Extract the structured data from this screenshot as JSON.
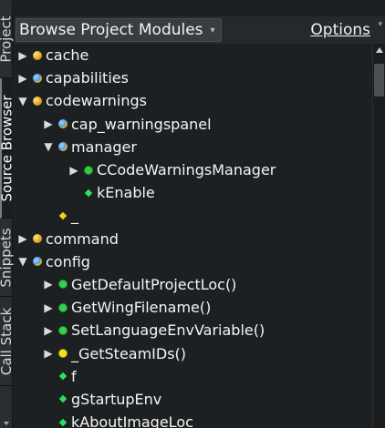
{
  "side_tabs": {
    "project": "Project",
    "source_browser": "Source Browser",
    "snippets": "Snippets",
    "call_stack": "Call Stack"
  },
  "header": {
    "mode_label": "Browse Project Modules",
    "options_label": "Options"
  },
  "icon_legend": {
    "package": "package-icon",
    "module": "python-module-icon",
    "class": "class-icon",
    "function": "function-icon",
    "function_private": "private-function-icon",
    "variable": "variable-icon"
  },
  "tree": [
    {
      "label": "cache",
      "expanded": false
    },
    {
      "label": "capabilities",
      "expanded": false
    },
    {
      "label": "codewarnings",
      "expanded": true
    },
    {
      "label": "cap_warningspanel",
      "expanded": false
    },
    {
      "label": "manager",
      "expanded": true
    },
    {
      "label": "CCodeWarningsManager",
      "expanded": false
    },
    {
      "label": "kEnable"
    },
    {
      "label": "_"
    },
    {
      "label": "command",
      "expanded": false
    },
    {
      "label": "config",
      "expanded": true
    },
    {
      "label": "GetDefaultProjectLoc()",
      "expanded": false
    },
    {
      "label": "GetWingFilename()",
      "expanded": false
    },
    {
      "label": "SetLanguageEnvVariable()",
      "expanded": false
    },
    {
      "label": "_GetSteamIDs()",
      "expanded": false
    },
    {
      "label": "f"
    },
    {
      "label": "gStartupEnv"
    },
    {
      "label": "kAboutImageLoc"
    }
  ]
}
